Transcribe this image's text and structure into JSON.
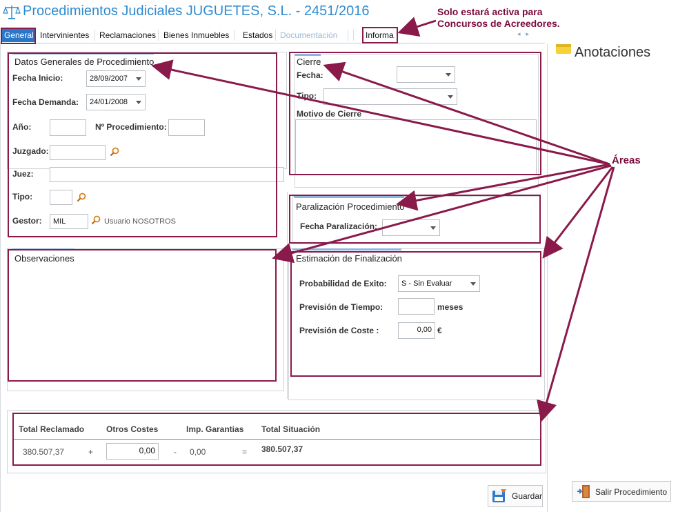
{
  "window": {
    "title": "Procedimientos Judiciales JUGUETES, S.L. - 2451/2016"
  },
  "tabs": [
    {
      "label": "General",
      "active": true
    },
    {
      "label": "Intervinientes"
    },
    {
      "label": "Reclamaciones"
    },
    {
      "label": "Bienes Inmuebles"
    },
    {
      "label": "Estados"
    },
    {
      "label": "Documentación",
      "disabled": true
    },
    {
      "label": "Informa"
    }
  ],
  "datos_generales": {
    "title": "Datos Generales de Procedimiento",
    "fecha_inicio_label": "Fecha Inicio:",
    "fecha_inicio_value": "28/09/2007",
    "fecha_demanda_label": "Fecha Demanda:",
    "fecha_demanda_value": "24/01/2008",
    "anio_label": "Año:",
    "anio_value": "",
    "num_proc_label": "Nº Procedimiento:",
    "num_proc_value": "",
    "juzgado_label": "Juzgado:",
    "juzgado_value": "",
    "juez_label": "Juez:",
    "juez_value": "",
    "tipo_label": "Tipo:",
    "tipo_value": "",
    "gestor_label": "Gestor:",
    "gestor_value": "MIL",
    "gestor_desc": "Usuario NOSOTROS"
  },
  "cierre": {
    "title": "Cierre",
    "fecha_label": "Fecha:",
    "tipo_label": "Tipo:",
    "motivo_label": "Motivo de Cierre"
  },
  "paralizacion": {
    "title": "Paralización Procedimiento",
    "fecha_label": "Fecha Paralización:"
  },
  "observaciones": {
    "title": "Observaciones"
  },
  "estimacion": {
    "title": "Estimación de Finalización",
    "probabilidad_label": "Probabilidad de Exito:",
    "probabilidad_value": "S - Sin Evaluar",
    "tiempo_label": "Previsión de Tiempo:",
    "tiempo_unit": "meses",
    "coste_label": "Previsión de Coste :",
    "coste_value": "0,00",
    "coste_unit": "€"
  },
  "totales": {
    "total_reclamado_label": "Total Reclamado",
    "otros_costes_label": "Otros Costes",
    "imp_garantias_label": "Imp. Garantias",
    "total_situacion_label": "Total Situación",
    "total_reclamado_value": "380.507,37",
    "plus": "+",
    "otros_costes_value": "0,00",
    "minus": "-",
    "imp_garantias_value": "0,00",
    "equals": "=",
    "total_situacion_value": "380.507,37"
  },
  "anotaciones": {
    "title": "Anotaciones"
  },
  "buttons": {
    "guardar": "Guardar",
    "salir": "Salir Procedimiento"
  },
  "annotations": {
    "note_line1": "Solo estará activa para",
    "note_line2": "Concursos de Acreedores.",
    "areas": "Áreas"
  },
  "colors": {
    "accent": "#2a77c9",
    "annotation": "#8a1a4a"
  }
}
